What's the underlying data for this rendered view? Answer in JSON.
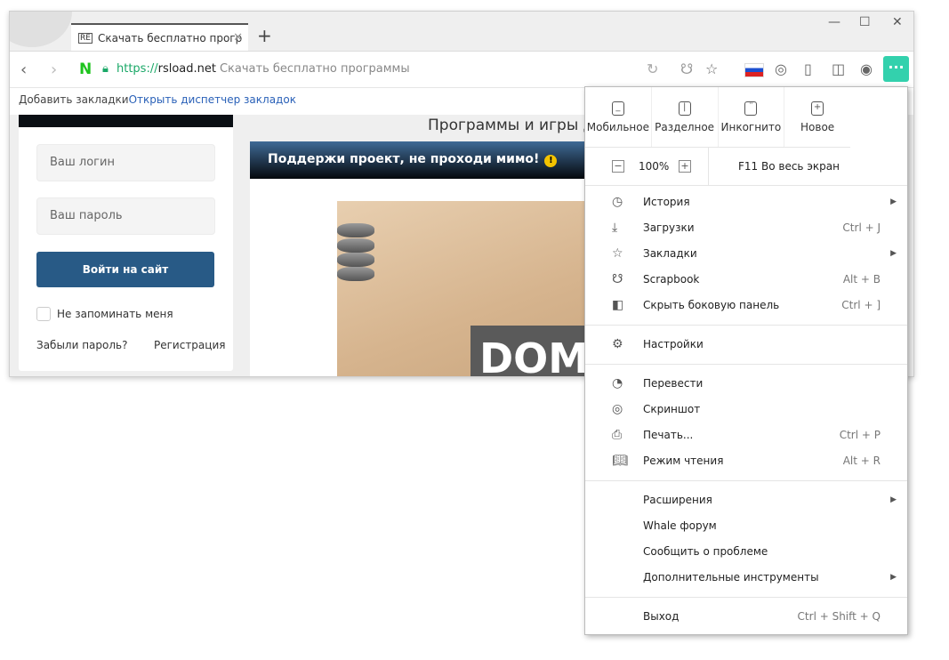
{
  "tab": {
    "title": "Скачать бесплатно прогр",
    "favicon": "RE"
  },
  "window_controls": {
    "minimize": "—",
    "maximize": "☐",
    "close": "✕"
  },
  "address": {
    "scheme": "https://",
    "domain": "rsload.net",
    "page_title": "Скачать бесплатно программы"
  },
  "bookmarks": {
    "add": "Добавить закладки",
    "manager": "Открыть диспетчер закладок"
  },
  "page": {
    "title": "Программы и игры дл",
    "login_placeholder": "Ваш логин",
    "password_placeholder": "Ваш пароль",
    "login_button": "Войти на сайт",
    "remember": "Не запоминать меня",
    "forgot": "Забыли пароль?",
    "register": "Регистрация",
    "banner": "Поддержи проект, не проходи мимо!",
    "sign_text": "DOM"
  },
  "menu": {
    "top": [
      {
        "label": "Мобильное",
        "icon": "mobile-icon"
      },
      {
        "label": "Разделное",
        "icon": "split-icon"
      },
      {
        "label": "Инкогнито",
        "icon": "incognito-icon"
      },
      {
        "label": "Новое",
        "icon": "new-window-icon"
      }
    ],
    "zoom": "100%",
    "fullscreen": "F11 Во весь экран",
    "group1": [
      {
        "label": "История",
        "shortcut": "",
        "submenu": true
      },
      {
        "label": "Загрузки",
        "shortcut": "Ctrl + J"
      },
      {
        "label": "Закладки",
        "shortcut": "",
        "submenu": true
      },
      {
        "label": "Scrapbook",
        "shortcut": "Alt + B"
      },
      {
        "label": "Скрыть боковую панель",
        "shortcut": "Ctrl + ]"
      }
    ],
    "settings": "Настройки",
    "group2": [
      {
        "label": "Перевести",
        "shortcut": ""
      },
      {
        "label": "Скриншот",
        "shortcut": ""
      },
      {
        "label": "Печать...",
        "shortcut": "Ctrl + P"
      },
      {
        "label": "Режим чтения",
        "shortcut": "Alt + R"
      }
    ],
    "group3": [
      {
        "label": "Расширения",
        "submenu": true
      },
      {
        "label": "Whale форум"
      },
      {
        "label": "Сообщить о проблеме"
      },
      {
        "label": "Дополнительные инструменты",
        "submenu": true
      }
    ],
    "exit": "Выход",
    "exit_shortcut": "Ctrl + Shift + Q"
  },
  "colors": {
    "accent": "#33d1ad",
    "login": "#285a86"
  }
}
